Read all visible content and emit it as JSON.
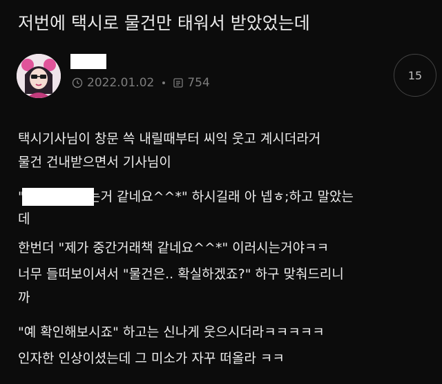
{
  "post": {
    "title": "저번에 택시로 물건만 태워서 받았었는데",
    "date": "2022.01.02",
    "views": "754",
    "comment_count": "15"
  },
  "icons": {
    "clock": "clock-icon",
    "views": "document-icon"
  },
  "body": {
    "lines": [
      "택시기사님이 창문 쓱 내릴때부터 씨익 웃고 계시더라거",
      "물건 건내받으면서 기사님이",
      "\"마약거래 하는거 같네요^^*\" 하시길래 아 넵ㅎ;하고 말았는",
      "데",
      "한번더 \"제가 중간거래책 같네요^^*\" 이러시는거야ㅋㅋ",
      "너무 들떠보이셔서 \"물건은.. 확실하겠죠?\" 하구 맞춰드리니",
      "까",
      "\"예 확인해보시죠\" 하고는 신나게 웃으시더라ㅋㅋㅋㅋㅋ",
      "인자한 인상이셨는데 그 미소가 자꾸 떠올라 ㅋㅋ"
    ]
  },
  "colors": {
    "background": "#0c0c0c",
    "text": "#ededed",
    "meta": "#7d7d7d",
    "redaction": "#ffffff"
  }
}
